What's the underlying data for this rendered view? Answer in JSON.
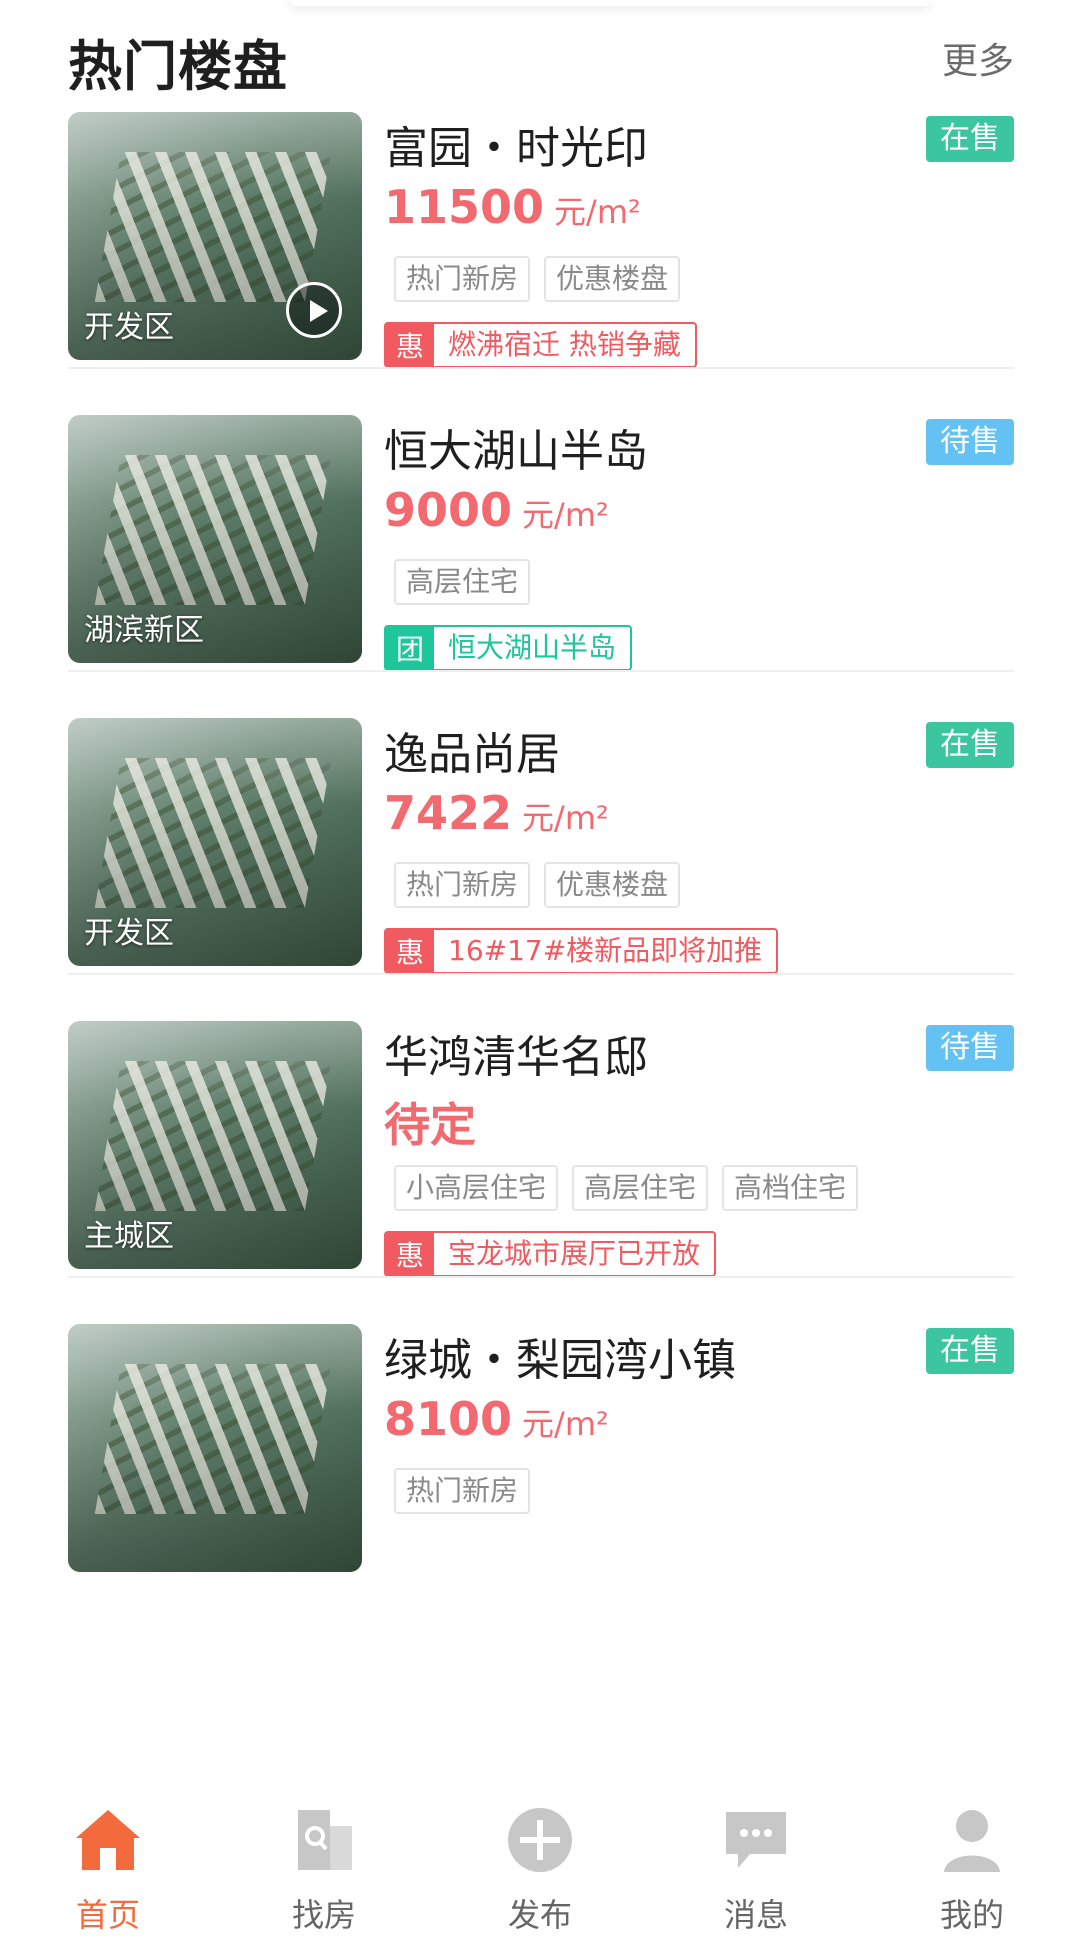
{
  "header": {
    "title": "热门楼盘",
    "more_label": "更多"
  },
  "listings": [
    {
      "name": "富园・时光印",
      "status": "在售",
      "price": "11500",
      "unit": "元/m²",
      "district": "开发区",
      "tags": [
        "热门新房",
        "优惠楼盘"
      ],
      "promo": {
        "mark": "惠",
        "text": "燃沸宿迁 热销争藏"
      }
    },
    {
      "name": "恒大湖山半岛",
      "status": "待售",
      "price": "9000",
      "unit": "元/m²",
      "district": "湖滨新区",
      "tags": [
        "高层住宅"
      ],
      "promo": {
        "mark": "团",
        "text": "恒大湖山半岛"
      }
    },
    {
      "name": "逸品尚居",
      "status": "在售",
      "price": "7422",
      "unit": "元/m²",
      "district": "开发区",
      "tags": [
        "热门新房",
        "优惠楼盘"
      ],
      "promo": {
        "mark": "惠",
        "text": "16#17#楼新品即将加推"
      }
    },
    {
      "name": "华鸿清华名邸",
      "status": "待售",
      "price": "待定",
      "unit": "",
      "district": "主城区",
      "tags": [
        "小高层住宅",
        "高层住宅",
        "高档住宅"
      ],
      "promo": {
        "mark": "惠",
        "text": "宝龙城市展厅已开放"
      }
    },
    {
      "name": "绿城・梨园湾小镇",
      "status": "在售",
      "price": "8100",
      "unit": "元/m²",
      "district": "",
      "tags": [
        "热门新房"
      ],
      "promo": null
    }
  ],
  "tabbar": {
    "items": [
      {
        "label": "首页",
        "icon": "home-icon",
        "active": true
      },
      {
        "label": "找房",
        "icon": "building-search-icon",
        "active": false
      },
      {
        "label": "发布",
        "icon": "plus-circle-icon",
        "active": false
      },
      {
        "label": "消息",
        "icon": "chat-bubble-icon",
        "active": false
      },
      {
        "label": "我的",
        "icon": "user-icon",
        "active": false
      }
    ]
  },
  "colors": {
    "price": "#f26a6f",
    "status_onsale": "#3cc6a0",
    "status_pending": "#63c1f3",
    "promo_hui": "#f05a60",
    "promo_tuan": "#1fc59b",
    "tab_active": "#f36b3d",
    "tab_inactive": "#c7c7c7"
  }
}
